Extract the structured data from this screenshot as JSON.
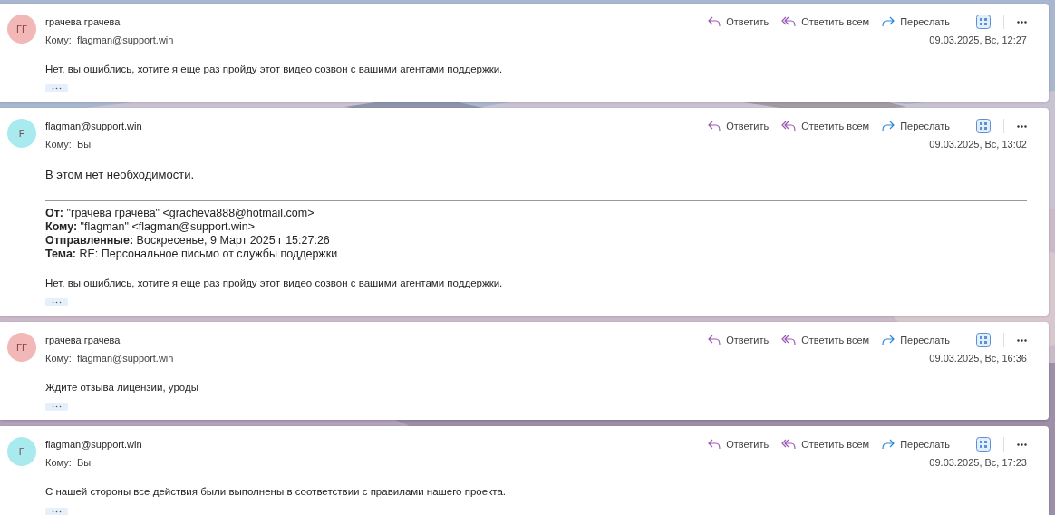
{
  "messages": [
    {
      "sender": "грачева грачева",
      "avatar": {
        "initials": "ГГ",
        "color": "#f2b8b8"
      },
      "to_label": "Кому:",
      "to": "flagman@support.win",
      "date": "09.03.2025, Вс, 12:27",
      "body": "Нет, вы ошиблись, хотите я еще раз пройду этот видео созвон с вашими агентами поддержки.",
      "actions": [
        {
          "kind": "reply",
          "label": "Ответить"
        },
        {
          "kind": "reply_all",
          "label": "Ответить всем"
        },
        {
          "kind": "forward",
          "label": "Переслать"
        }
      ]
    },
    {
      "sender": "flagman@support.win",
      "avatar": {
        "initials": "F",
        "color": "#a8eaee"
      },
      "to_label": "Кому:",
      "to": "Вы",
      "date": "09.03.2025, Вс, 13:02",
      "body": "В этом нет необходимости.",
      "quoted": {
        "fields": [
          {
            "label": "От:",
            "value": "\"грачева грачева\" <gracheva888@hotmail.com>"
          },
          {
            "label": "Кому:",
            "value": "\"flagman\" <flagman@support.win>"
          },
          {
            "label": "Отправленные:",
            "value": "Воскресенье, 9 Март 2025 г 15:27:26"
          },
          {
            "label": "Тема:",
            "value": "RE: Персональное письмо от службы поддержки"
          }
        ],
        "body": "Нет, вы ошиблись, хотите я еще раз пройду этот видео созвон с вашими агентами поддержки."
      },
      "actions": [
        {
          "kind": "reply",
          "label": "Ответить"
        },
        {
          "kind": "reply_all",
          "label": "Ответить всем"
        },
        {
          "kind": "forward",
          "label": "Переслать"
        }
      ]
    },
    {
      "sender": "грачева грачева",
      "avatar": {
        "initials": "ГГ",
        "color": "#f2b8b8"
      },
      "to_label": "Кому:",
      "to": "flagman@support.win",
      "date": "09.03.2025, Вс, 16:36",
      "body": "Ждите отзыва лицензии, уроды",
      "actions": [
        {
          "kind": "reply",
          "label": "Ответить"
        },
        {
          "kind": "reply_all",
          "label": "Ответить всем"
        },
        {
          "kind": "forward",
          "label": "Переслать"
        }
      ]
    },
    {
      "sender": "flagman@support.win",
      "avatar": {
        "initials": "F",
        "color": "#a8eaee"
      },
      "to_label": "Кому:",
      "to": "Вы",
      "date": "09.03.2025, Вс, 17:23",
      "body": "С нашей стороны все действия были выполнены в соответствии с правилами нашего проекта.",
      "actions": [
        {
          "kind": "reply",
          "label": "Ответить"
        },
        {
          "kind": "reply_all",
          "label": "Ответить всем"
        },
        {
          "kind": "forward",
          "label": "Переслать"
        }
      ]
    }
  ]
}
